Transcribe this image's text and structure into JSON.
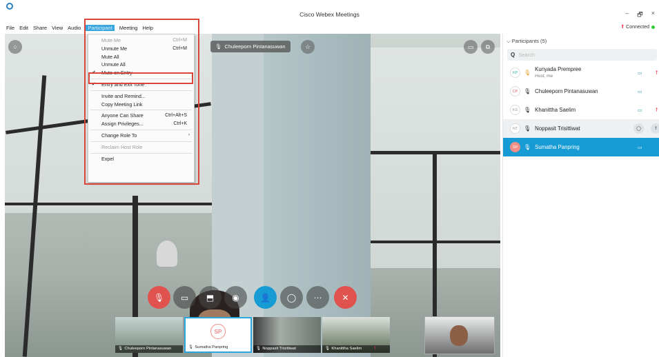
{
  "window": {
    "title": "Cisco Webex Meetings",
    "minimize": "–",
    "restore": "🗗",
    "close": "×"
  },
  "menubar": [
    "File",
    "Edit",
    "Share",
    "View",
    "Audio",
    "Participant",
    "Meeting",
    "Help"
  ],
  "connection": {
    "label": "Connected"
  },
  "stage": {
    "active_speaker": "Chuleeporn Pintanasuwan"
  },
  "participant_menu": {
    "items": [
      {
        "label": "Mute Me",
        "shortcut": "Ctrl+M",
        "disabled": true
      },
      {
        "label": "Unmute Me",
        "shortcut": "Ctrl+M"
      },
      {
        "label": "Mute All"
      },
      {
        "label": "Unmute All"
      },
      {
        "label": "Mute on Entry",
        "checked": true
      },
      {
        "label": "Entry and Exit Tone",
        "checked": true
      },
      {
        "label": "Invite and Remind..."
      },
      {
        "label": "Copy Meeting Link"
      },
      {
        "label": "Anyone Can Share",
        "shortcut": "Ctrl+Alt+S"
      },
      {
        "label": "Assign Privileges...",
        "shortcut": "Ctrl+K"
      },
      {
        "label": "Change Role To",
        "submenu": true
      },
      {
        "label": "Reclaim Host Role",
        "disabled": true
      },
      {
        "label": "Expel"
      }
    ]
  },
  "thumbnails": [
    {
      "name": "Chuleeporn Pintanasuwan"
    },
    {
      "name": "Sumatha Panpring",
      "initials": "SP"
    },
    {
      "name": "Noppasit Trisittiwat"
    },
    {
      "name": "Khanittha Saelim"
    }
  ],
  "panel": {
    "header": "Participants (5)",
    "search_placeholder": "Search",
    "participants": [
      {
        "initials": "KP",
        "name": "Kunyada Prempree",
        "role": "Host, me"
      },
      {
        "initials": "CP",
        "name": "Chuleeporn Pintanasuwan"
      },
      {
        "initials": "KS",
        "name": "Khanittha Saelim"
      },
      {
        "initials": "NT",
        "name": "Noppasit Trisittiwat"
      },
      {
        "initials": "SP",
        "name": "Sumatha Panpring"
      }
    ]
  },
  "colors": {
    "accent": "#169bd5",
    "highlight": "#d9443b",
    "end_call": "#e0524d"
  }
}
